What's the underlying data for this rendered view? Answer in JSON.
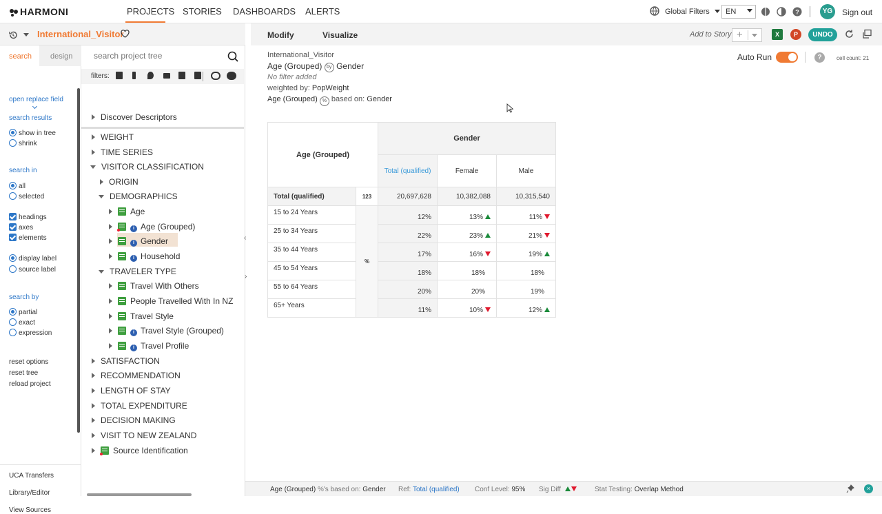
{
  "app": {
    "name": "HARMONI"
  },
  "nav": {
    "tabs": [
      "PROJECTS",
      "STORIES",
      "DASHBOARDS",
      "ALERTS"
    ],
    "active": "PROJECTS"
  },
  "topright": {
    "global_filters": "Global Filters",
    "language": "EN",
    "user_initials": "YG",
    "sign_out": "Sign out"
  },
  "project": {
    "name": "International_Visitor"
  },
  "search_panel": {
    "tab_search": "search",
    "tab_design": "design",
    "open_replace": "open replace field",
    "search_results_label": "search results",
    "show_in_tree": "show in tree",
    "shrink": "shrink",
    "search_in_label": "search in",
    "all": "all",
    "selected": "selected",
    "headings": "headings",
    "axes": "axes",
    "elements": "elements",
    "display_label": "display label",
    "source_label": "source label",
    "search_by_label": "search by",
    "partial": "partial",
    "exact": "exact",
    "expression": "expression",
    "reset_options": "reset options",
    "reset_tree": "reset tree",
    "reload_project": "reload project",
    "uca_transfers": "UCA Transfers",
    "library_editor": "Library/Editor",
    "view_sources": "View Sources"
  },
  "tree": {
    "search_placeholder": "search project tree",
    "filters_label": "filters:",
    "nodes": {
      "discover": "Discover Descriptors",
      "weight": "WEIGHT",
      "time_series": "TIME SERIES",
      "visitor_classification": "VISITOR CLASSIFICATION",
      "origin": "ORIGIN",
      "demographics": "DEMOGRAPHICS",
      "age": "Age",
      "age_grouped": "Age (Grouped)",
      "gender": "Gender",
      "household": "Household",
      "traveler_type": "TRAVELER TYPE",
      "travel_with_others": "Travel With Others",
      "people_travelled": "People Travelled With In NZ",
      "travel_style": "Travel Style",
      "travel_style_grouped": "Travel Style (Grouped)",
      "travel_profile": "Travel Profile",
      "satisfaction": "SATISFACTION",
      "recommendation": "RECOMMENDATION",
      "length_of_stay": "LENGTH OF STAY",
      "total_expenditure": "TOTAL EXPENDITURE",
      "decision_making": "DECISION MAKING",
      "visit_nz": "VISIT TO NEW ZEALAND",
      "source_identification": "Source Identification"
    }
  },
  "main": {
    "tab_modify": "Modify",
    "tab_visualize": "Visualize",
    "add_to_story": "Add to Story",
    "undo": "UNDO",
    "auto_run": "Auto Run",
    "cell_count": "cell count: 21",
    "source": "International_Visitor",
    "row_var": "Age (Grouped)",
    "col_var": "Gender",
    "no_filter": "No filter added",
    "weighted_by_label": "weighted by:",
    "weighted_by": "PopWeight",
    "based_on_label": "based on:",
    "based_on": "Gender"
  },
  "crosstab": {
    "row_header": "Age (Grouped)",
    "col_header": "Gender",
    "columns": [
      "Total (qualified)",
      "Female",
      "Male"
    ],
    "total_row_label": "Total (qualified)",
    "total_badge": "123",
    "total_values": [
      "20,697,628",
      "10,382,088",
      "10,315,540"
    ],
    "pct_badge": "%",
    "rows": [
      {
        "label": "15 to 24 Years",
        "values": [
          "12%",
          "13%",
          "11%"
        ],
        "sig": [
          "",
          "up",
          "down"
        ]
      },
      {
        "label": "25 to 34 Years",
        "values": [
          "22%",
          "23%",
          "21%"
        ],
        "sig": [
          "",
          "up",
          "down"
        ]
      },
      {
        "label": "35 to 44 Years",
        "values": [
          "17%",
          "16%",
          "19%"
        ],
        "sig": [
          "",
          "down",
          "up"
        ]
      },
      {
        "label": "45 to 54 Years",
        "values": [
          "18%",
          "18%",
          "18%"
        ],
        "sig": [
          "",
          "",
          ""
        ]
      },
      {
        "label": "55 to 64 Years",
        "values": [
          "20%",
          "20%",
          "19%"
        ],
        "sig": [
          "",
          "",
          ""
        ]
      },
      {
        "label": "65+ Years",
        "values": [
          "11%",
          "10%",
          "12%"
        ],
        "sig": [
          "",
          "down",
          "up"
        ]
      }
    ]
  },
  "statusbar": {
    "row_var": "Age (Grouped)",
    "pct_based_label": "%'s based on:",
    "pct_based": "Gender",
    "ref_label": "Ref:",
    "ref": "Total (qualified)",
    "conf_label": "Conf Level:",
    "conf": "95%",
    "sig_label": "Sig Diff",
    "stat_label": "Stat Testing:",
    "stat": "Overlap Method"
  }
}
